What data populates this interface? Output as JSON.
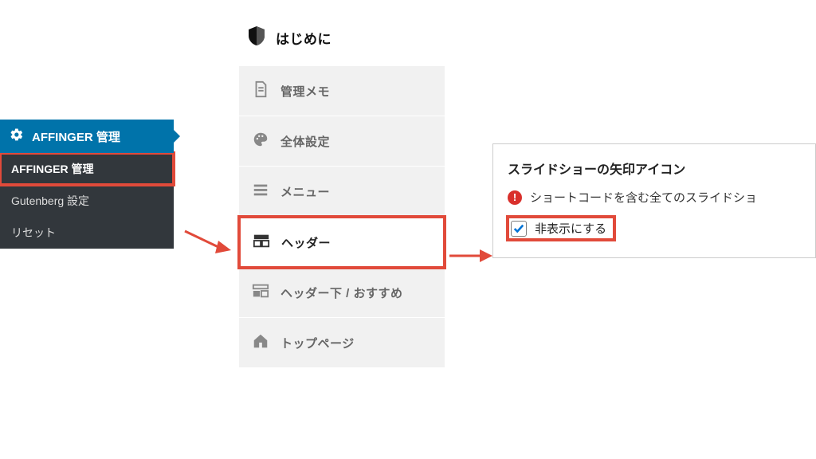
{
  "wp_sidebar": {
    "active_label": "AFFINGER 管理",
    "items": [
      {
        "label": "AFFINGER 管理"
      },
      {
        "label": "Gutenberg 設定"
      },
      {
        "label": "リセット"
      }
    ]
  },
  "mid_menu": {
    "header": "はじめに",
    "items": [
      {
        "label": "管理メモ"
      },
      {
        "label": "全体設定"
      },
      {
        "label": "メニュー"
      },
      {
        "label": "ヘッダー"
      },
      {
        "label": "ヘッダー下 / おすすめ"
      },
      {
        "label": "トップページ"
      }
    ]
  },
  "right_panel": {
    "title": "スライドショーの矢印アイコン",
    "warning": "ショートコードを含む全てのスライドショ",
    "checkbox_label": "非表示にする"
  }
}
